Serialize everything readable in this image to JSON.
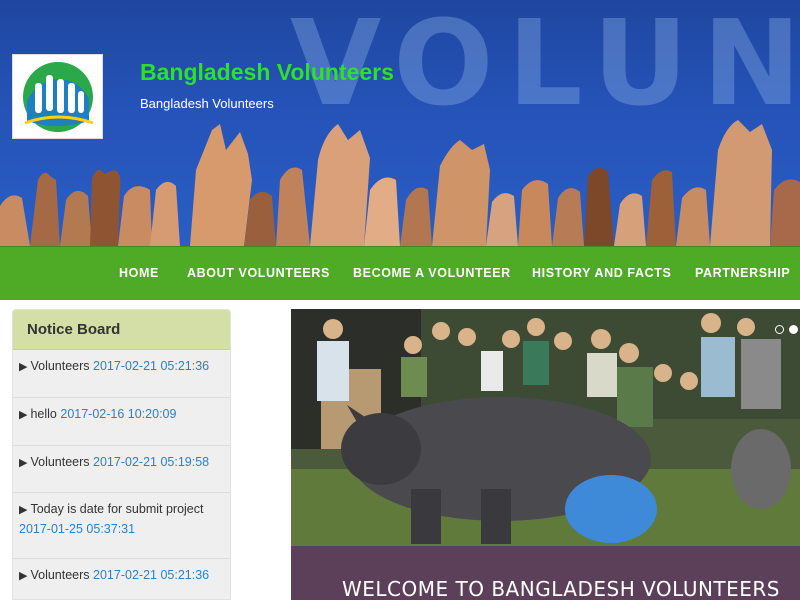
{
  "header": {
    "bg_word": "VOLUNTEERS",
    "logo": "hands-logo",
    "title": "Bangladesh Volunteers",
    "subtitle": "Bangladesh Volunteers",
    "colors": {
      "banner": "#2553b8",
      "title": "#2ee02a"
    }
  },
  "nav": {
    "color": "#4faa25",
    "items": [
      {
        "label": "HOME"
      },
      {
        "label": "ABOUT VOLUNTEERS"
      },
      {
        "label": "BECOME A VOLUNTEER"
      },
      {
        "label": "HISTORY AND FACTS"
      },
      {
        "label": "PARTNERSHIP"
      }
    ]
  },
  "notice_board": {
    "title": "Notice Board",
    "bullet_icon": "triangle-right-icon",
    "items": [
      {
        "text": "Volunteers",
        "date": "2017-02-21 05:21:36"
      },
      {
        "text": "hello",
        "date": "2017-02-16 10:20:09"
      },
      {
        "text": "Volunteers",
        "date": "2017-02-21 05:19:58"
      },
      {
        "text": "Today is date for submit project",
        "date": "2017-01-25 05:37:31"
      },
      {
        "text": "Volunteers",
        "date": "2017-02-21 05:21:36"
      }
    ]
  },
  "slider": {
    "image": "volunteers-with-rhino-photo",
    "welcome": "WELCOME TO BANGLADESH VOLUNTEERS",
    "active_slide": 2,
    "slide_count": 2
  }
}
